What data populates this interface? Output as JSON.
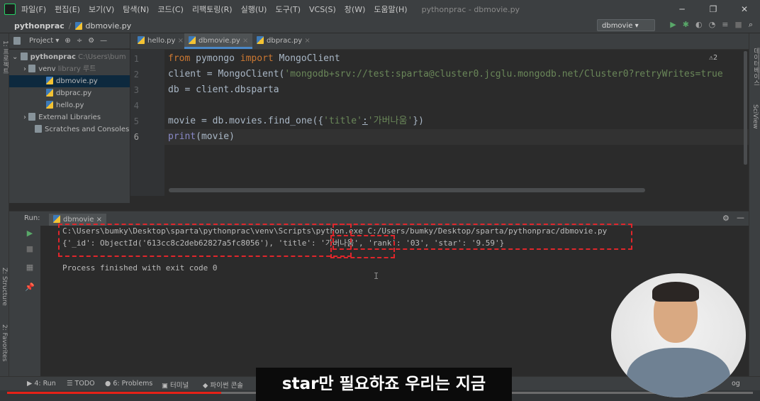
{
  "titlebar": {
    "menu": [
      "파일(F)",
      "편집(E)",
      "보기(V)",
      "탐색(N)",
      "코드(C)",
      "리팩토링(R)",
      "실행(U)",
      "도구(T)",
      "VCS(S)",
      "창(W)",
      "도움말(H)"
    ],
    "title": "pythonprac - dbmovie.py",
    "minimize": "─",
    "restore": "❐",
    "close": "✕"
  },
  "navbar": {
    "project": "pythonprac",
    "file": "dbmovie.py",
    "run_config": "dbmovie ▾"
  },
  "left_stripe": {
    "project_label": "1: 프로젝트",
    "structure_label": "Z: Structure",
    "favorites_label": "2: Favorites"
  },
  "right_stripe": {
    "db_label": "데이터베이스",
    "sciview_label": "SciView"
  },
  "project_panel": {
    "header": "Project ▾",
    "items": [
      {
        "label": "pythonprac",
        "hint": "C:\\Users\\bum"
      },
      {
        "label": "venv",
        "hint": "library 루트"
      },
      {
        "label": "dbmovie.py"
      },
      {
        "label": "dbprac.py"
      },
      {
        "label": "hello.py"
      },
      {
        "label": "External Libraries"
      },
      {
        "label": "Scratches and Consoles"
      }
    ]
  },
  "tabs": [
    {
      "label": "hello.py"
    },
    {
      "label": "dbmovie.py"
    },
    {
      "label": "dbprac.py"
    }
  ],
  "editor": {
    "line_numbers": [
      "1",
      "2",
      "3",
      "4",
      "5",
      "6"
    ],
    "warning": "⚠2",
    "lines": {
      "l1_kw1": "from",
      "l1_mod": " pymongo ",
      "l1_kw2": "import",
      "l1_cls": " MongoClient",
      "l2_pre": "client = MongoClient(",
      "l2_str": "'mongodb+srv://test:sparta@cluster0.jcglu.mongodb.net/Cluster0?retryWrites=true",
      "l3": "db = client.dbsparta",
      "l5_pre": "movie = db.movies.find_one({",
      "l5_key": "'title'",
      "l5_colon": ":",
      "l5_val": "'가버나움'",
      "l5_post": "})",
      "l6_fn": "print",
      "l6_rest": "(movie)"
    }
  },
  "run_panel": {
    "label": "Run:",
    "config": "dbmovie",
    "console": [
      "C:\\Users\\bumky\\Desktop\\sparta\\pythonprac\\venv\\Scripts\\python.exe C:/Users/bumky/Desktop/sparta/pythonprac/dbmovie.py",
      "{'_id': ObjectId('613cc8c2deb62827a5fc8056'), 'title': '가버나움', 'rank': '03', 'star': '9.59'}",
      "Process finished with exit code 0"
    ]
  },
  "bottom_bar": {
    "run": "4: Run",
    "todo": "TODO",
    "problems": "6: Problems",
    "terminal": "터미널",
    "python_console": "파이썬 콘솔",
    "event_log": "og"
  },
  "video": {
    "subtitle": "star만 필요하죠 우리는 지금",
    "progress": 0.287
  },
  "colors": {
    "accent": "#4a88c7",
    "highlight": "#e0262b",
    "keyword": "#cc7832",
    "string": "#6a8759"
  }
}
